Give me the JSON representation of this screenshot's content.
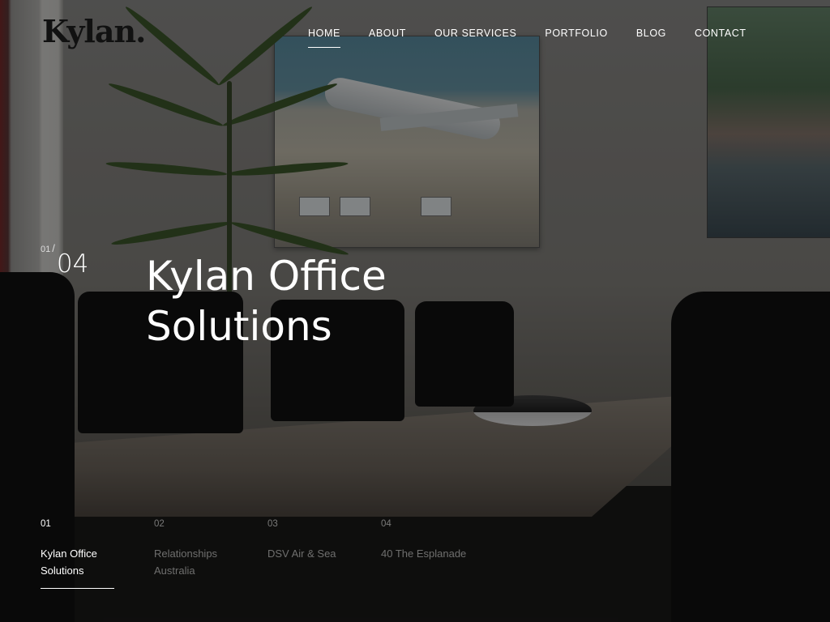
{
  "brand": {
    "logo_text": "Kylan",
    "logo_dot": "."
  },
  "nav": {
    "items": [
      {
        "label": "HOME",
        "active": true
      },
      {
        "label": "ABOUT",
        "active": false
      },
      {
        "label": "OUR SERVICES",
        "active": false
      },
      {
        "label": "PORTFOLIO",
        "active": false
      },
      {
        "label": "BLOG",
        "active": false
      },
      {
        "label": "CONTACT",
        "active": false
      }
    ]
  },
  "slider": {
    "current": "01",
    "separator": "/",
    "total": "04",
    "title_line1": "Kylan Office",
    "title_line2": "Solutions",
    "tabs": [
      {
        "num": "01",
        "label": "Kylan Office Solutions",
        "active": true
      },
      {
        "num": "02",
        "label": "Relationships Australia",
        "active": false
      },
      {
        "num": "03",
        "label": "DSV Air & Sea",
        "active": false
      },
      {
        "num": "04",
        "label": "40 The Esplanade",
        "active": false
      }
    ]
  },
  "colors": {
    "logo": "#111111",
    "text": "#ffffff",
    "overlay": "rgba(0,0,0,0.45)"
  }
}
